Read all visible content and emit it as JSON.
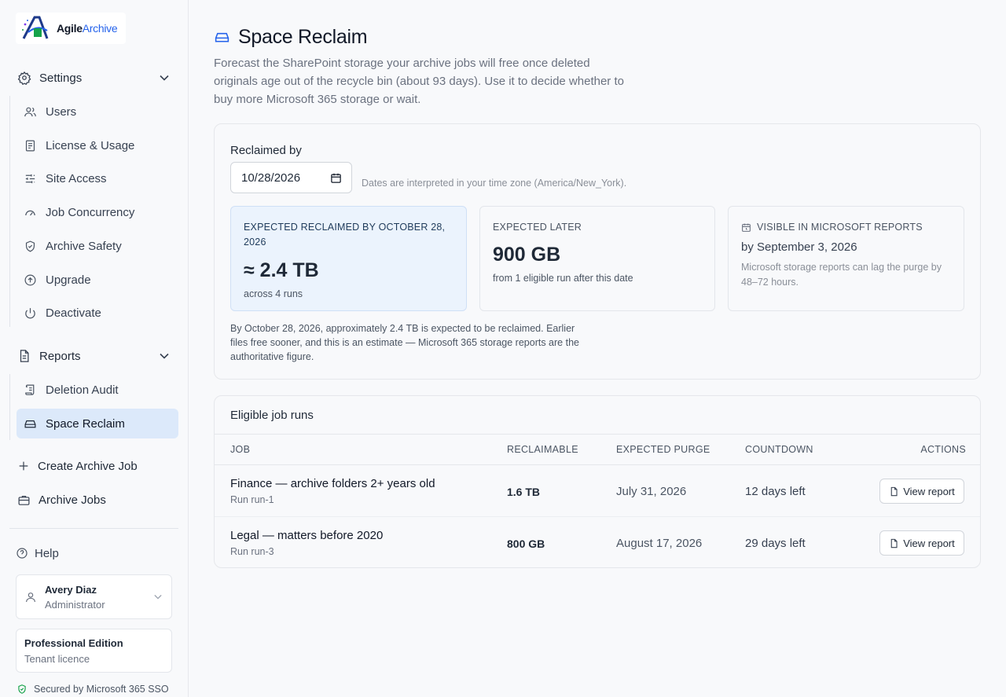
{
  "brand": {
    "name_part1": "Agile",
    "name_part2": "Archive"
  },
  "sidebar": {
    "settings": {
      "label": "Settings",
      "items": [
        {
          "label": "Users"
        },
        {
          "label": "License & Usage"
        },
        {
          "label": "Site Access"
        },
        {
          "label": "Job Concurrency"
        },
        {
          "label": "Archive Safety"
        },
        {
          "label": "Upgrade"
        },
        {
          "label": "Deactivate"
        }
      ]
    },
    "reports": {
      "label": "Reports",
      "items": [
        {
          "label": "Deletion Audit"
        },
        {
          "label": "Space Reclaim",
          "active": true
        }
      ]
    },
    "create_job": "Create Archive Job",
    "archive_jobs": "Archive Jobs",
    "help": "Help",
    "user": {
      "name": "Avery Diaz",
      "role": "Administrator"
    },
    "edition": {
      "name": "Professional Edition",
      "sub": "Tenant licence"
    },
    "secured": "Secured by Microsoft 365 SSO"
  },
  "page": {
    "title": "Space Reclaim",
    "description": "Forecast the SharePoint storage your archive jobs will free once deleted originals age out of the recycle bin (about 93 days). Use it to decide whether to buy more Microsoft 365 storage or wait."
  },
  "summary": {
    "reclaimed_by_label": "Reclaimed by",
    "date_value": "10/28/2026",
    "tz_note": "Dates are interpreted in your time zone (America/New_York).",
    "expected": {
      "label": "Expected reclaimed by October 28, 2026",
      "value": "≈ 2.4 TB",
      "sub": "across 4 runs"
    },
    "later": {
      "label": "Expected later",
      "value": "900 GB",
      "sub": "from 1 eligible run after this date"
    },
    "visible": {
      "label": "Visible in Microsoft reports",
      "value": "by September 3, 2026",
      "sub": "Microsoft storage reports can lag the purge by 48–72 hours."
    },
    "note": "By October 28, 2026, approximately 2.4 TB is expected to be reclaimed. Earlier files free sooner, and this is an estimate — Microsoft 365 storage reports are the authoritative figure."
  },
  "runs": {
    "title": "Eligible job runs",
    "columns": [
      "Job",
      "Reclaimable",
      "Expected purge",
      "Countdown",
      "Actions"
    ],
    "rows": [
      {
        "job": "Finance — archive folders 2+ years old",
        "run": "Run run-1",
        "reclaimable": "1.6 TB",
        "purge": "July 31, 2026",
        "countdown": "12 days left",
        "action": "View report"
      },
      {
        "job": "Legal — matters before 2020",
        "run": "Run run-3",
        "reclaimable": "800 GB",
        "purge": "August 17, 2026",
        "countdown": "29 days left",
        "action": "View report"
      }
    ]
  },
  "colors": {
    "accent": "#2563eb",
    "active_nav_bg": "#dce9fa",
    "highlight_card_bg": "#ebf3fd"
  }
}
